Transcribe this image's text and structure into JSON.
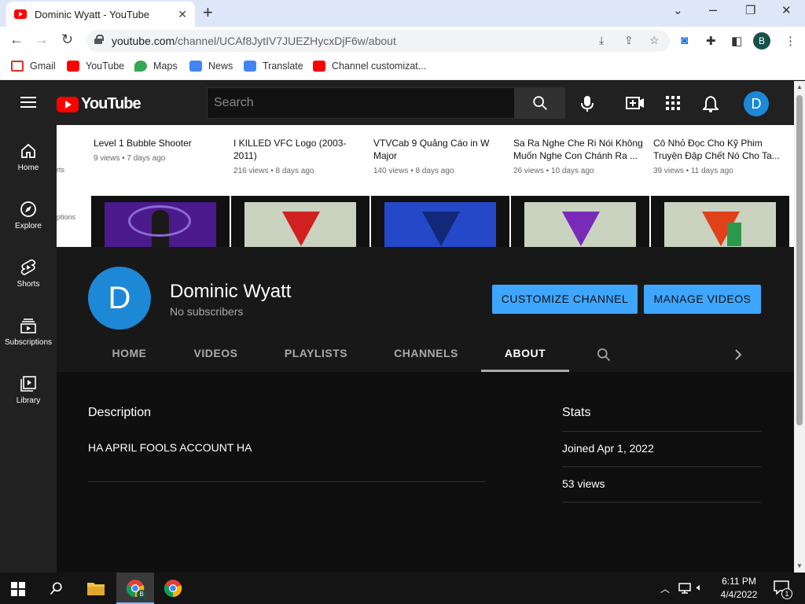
{
  "browser": {
    "tab_title": "Dominic Wyatt - YouTube",
    "tab_close": "✕",
    "new_tab": "+",
    "url_host": "youtube.com",
    "url_path": "/channel/UCAf8JytIV7JUEZHycxDjF6w/about",
    "profile_letter": "B",
    "bookmarks": [
      {
        "label": "Gmail",
        "color": "#d93025"
      },
      {
        "label": "YouTube",
        "color": "#ff0000"
      },
      {
        "label": "Maps",
        "color": "#34a853"
      },
      {
        "label": "News",
        "color": "#4285f4"
      },
      {
        "label": "Translate",
        "color": "#4285f4"
      },
      {
        "label": "Channel customizat...",
        "color": "#ff0000"
      }
    ]
  },
  "youtube": {
    "logo_text": "YouTube",
    "search_placeholder": "Search",
    "avatar_letter": "D",
    "guide": [
      {
        "label": "Home"
      },
      {
        "label": "Explore"
      },
      {
        "label": "Shorts"
      },
      {
        "label": "Subscriptions"
      },
      {
        "label": "Library"
      }
    ],
    "strip_side": [
      "rts",
      "ptions"
    ],
    "videos": [
      {
        "title": "Level 1 Bubble Shooter",
        "meta": "9 views • 7 days ago",
        "thumb_color": "#4b1a8c",
        "v_color": "#2a2f7a"
      },
      {
        "title": "I KILLED VFC Logo (2003-2011)",
        "meta": "216 views • 8 days ago",
        "thumb_color": "#c9d3c0",
        "v_color": "#d02020"
      },
      {
        "title": "VTVCab 9 Quảng Cáo in W Major",
        "meta": "140 views • 8 days ago",
        "thumb_color": "#2448c8",
        "v_color": "#14287a"
      },
      {
        "title": "Sa Ra Nghe Che Ri Nói Không Muốn Nghe Con Chánh Ra ...",
        "meta": "26 views • 10 days ago",
        "thumb_color": "#c9d3c0",
        "v_color": "#7a2ab8"
      },
      {
        "title": "Cô Nhỏ Đọc Cho Kỹ Phim Truyện Đập Chết Nó Cho Ta...",
        "meta": "39 views • 11 days ago",
        "thumb_color": "#c9d3c0",
        "v_color": "#e0401a"
      }
    ],
    "channel": {
      "avatar_letter": "D",
      "name": "Dominic Wyatt",
      "subscribers": "No subscribers",
      "customize_label": "CUSTOMIZE CHANNEL",
      "manage_label": "MANAGE VIDEOS",
      "tabs": [
        "HOME",
        "VIDEOS",
        "PLAYLISTS",
        "CHANNELS",
        "ABOUT"
      ],
      "active_tab": "ABOUT"
    },
    "about": {
      "description_heading": "Description",
      "description": "HA APRIL FOOLS ACCOUNT HA",
      "stats_heading": "Stats",
      "joined": "Joined Apr 1, 2022",
      "views": "53 views"
    }
  },
  "taskbar": {
    "time": "6:11 PM",
    "date": "4/4/2022",
    "notification_count": "1"
  },
  "colors": {
    "accent_blue": "#3ea6ff",
    "youtube_red": "#ff0000",
    "avatar_blue": "#1c88d6"
  }
}
